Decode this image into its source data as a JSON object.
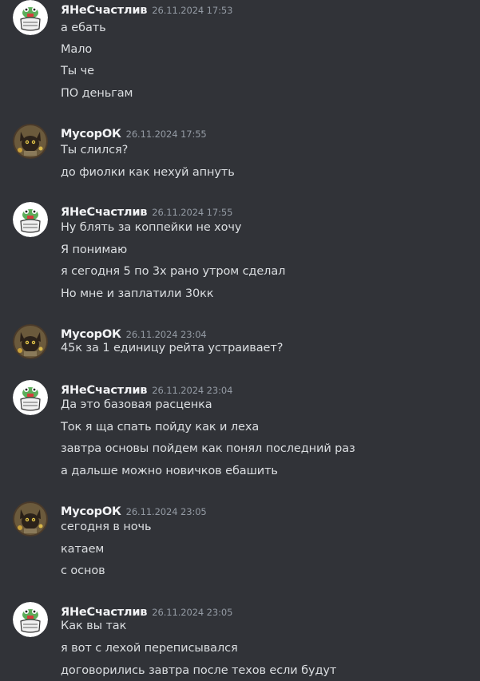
{
  "users": {
    "ya": {
      "name": "ЯНеСчастлив",
      "avatar": "frog-avatar-icon"
    },
    "musor": {
      "name": "МусорОК",
      "avatar": "cat-avatar-icon"
    }
  },
  "groups": [
    {
      "author": "ЯНеСчастлив",
      "timestamp": "26.11.2024 17:53",
      "messages": [
        "а ебать",
        "Мало",
        "Ты че",
        "ПО деньгам"
      ]
    },
    {
      "author": "МусорОК",
      "timestamp": "26.11.2024 17:55",
      "messages": [
        "Ты слился?",
        "до фиолки как нехуй апнуть"
      ]
    },
    {
      "author": "ЯНеСчастлив",
      "timestamp": "26.11.2024 17:55",
      "messages": [
        "Ну блять за коппейки не хочу",
        "Я понимаю",
        "я сегодня 5 по 3х рано утром сделал",
        "Но мне и заплатили 30кк"
      ]
    },
    {
      "author": "МусорОК",
      "timestamp": "26.11.2024 23:04",
      "messages": [
        "45к за 1 единицу рейта устраивает?"
      ]
    },
    {
      "author": "ЯНеСчастлив",
      "timestamp": "26.11.2024 23:04",
      "messages": [
        "Да это базовая расценка",
        "Ток я ща спать пойду как и леха",
        "завтра основы пойдем как понял последний раз",
        "а дальше можно новичков ебашить"
      ]
    },
    {
      "author": "МусорОК",
      "timestamp": "26.11.2024 23:05",
      "messages": [
        "сегодня в ночь",
        "катаем",
        "с основ"
      ]
    },
    {
      "author": "ЯНеСчастлив",
      "timestamp": "26.11.2024 23:05",
      "messages": [
        "Как вы так",
        "я вот с лехой переписывался",
        "договорились завтра после техов если будут"
      ]
    }
  ]
}
